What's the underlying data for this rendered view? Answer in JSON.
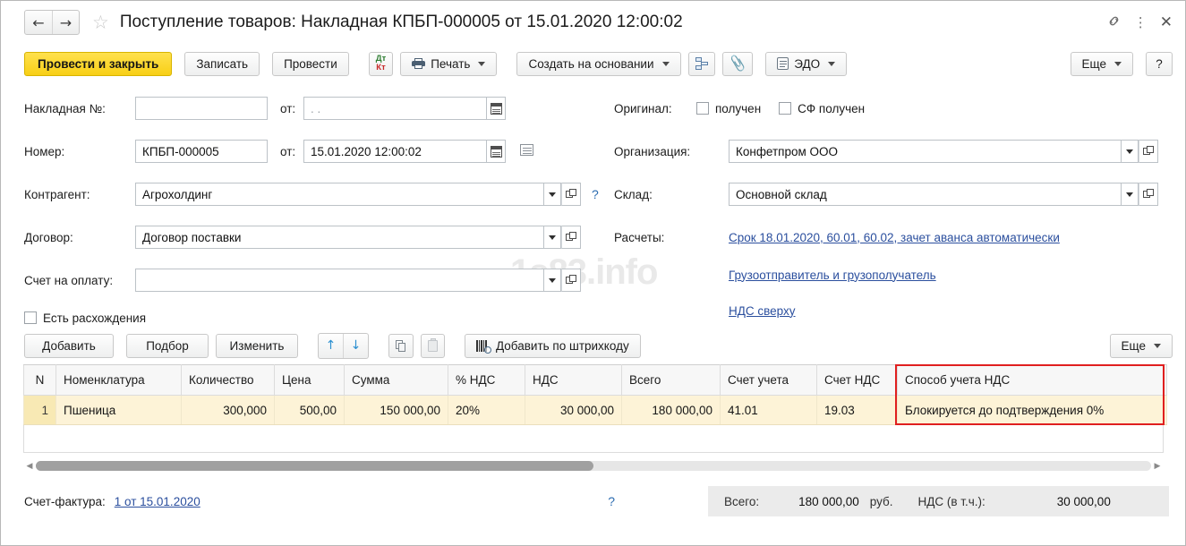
{
  "window": {
    "title": "Поступление товаров: Накладная КПБП-000005 от 15.01.2020 12:00:02",
    "back_icon": "←",
    "forward_icon": "→",
    "favorite_icon": "☆",
    "link_icon": "🔗",
    "kebab_icon": "⋮",
    "close_icon": "✕"
  },
  "toolbar": {
    "post_and_close": "Провести и закрыть",
    "write": "Записать",
    "post": "Провести",
    "dt": "Дт",
    "kt": "Кт",
    "print": "Печать",
    "create_based_on": "Создать на основании",
    "edo": "ЭДО",
    "more": "Еще",
    "help": "?"
  },
  "form": {
    "invoice_no_label": "Накладная №:",
    "invoice_no_value": "",
    "invoice_from_label": "от:",
    "invoice_from_value": ".  .",
    "number_label": "Номер:",
    "number_value": "КПБП-000005",
    "number_from_label": "от:",
    "number_from_value": "15.01.2020 12:00:02",
    "counterparty_label": "Контрагент:",
    "counterparty_value": "Агрохолдинг",
    "contract_label": "Договор:",
    "contract_value": "Договор поставки",
    "payment_invoice_label": "Счет на оплату:",
    "payment_invoice_value": "",
    "discrepancies_label": "Есть расхождения",
    "original_label": "Оригинал:",
    "original_received": "получен",
    "sf_received": "СФ получен",
    "organization_label": "Организация:",
    "organization_value": "Конфетпром ООО",
    "warehouse_label": "Склад:",
    "warehouse_value": "Основной склад",
    "settlements_label": "Расчеты:",
    "settlements_link": "Срок 18.01.2020, 60.01, 60.02, зачет аванса автоматически",
    "shipper_link": "Грузоотправитель и грузополучатель",
    "vat_on_top_link": "НДС сверху",
    "help_icon": "?"
  },
  "table_toolbar": {
    "add": "Добавить",
    "select": "Подбор",
    "change": "Изменить",
    "move_up": "↑",
    "move_down": "↓",
    "add_by_barcode": "Добавить по штрихкоду",
    "more": "Еще"
  },
  "table": {
    "columns": [
      "N",
      "Номенклатура",
      "Количество",
      "Цена",
      "Сумма",
      "% НДС",
      "НДС",
      "Всего",
      "Счет учета",
      "Счет НДС",
      "Способ учета НДС"
    ],
    "rows": [
      {
        "n": "1",
        "nomenclature": "Пшеница",
        "quantity": "300,000",
        "price": "500,00",
        "amount": "150 000,00",
        "vat_percent": "20%",
        "vat": "30 000,00",
        "total": "180 000,00",
        "account": "41.01",
        "vat_account": "19.03",
        "vat_method": "Блокируется до подтверждения 0%"
      }
    ],
    "highlight_color": "#e01f1f"
  },
  "footer": {
    "invoice_label": "Счет-фактура:",
    "invoice_link": "1 от 15.01.2020",
    "help_icon": "?",
    "total_label": "Всего:",
    "total_value": "180 000,00",
    "currency": "руб.",
    "vat_label": "НДС (в т.ч.):",
    "vat_value": "30 000,00"
  },
  "watermark": "1s83.info"
}
